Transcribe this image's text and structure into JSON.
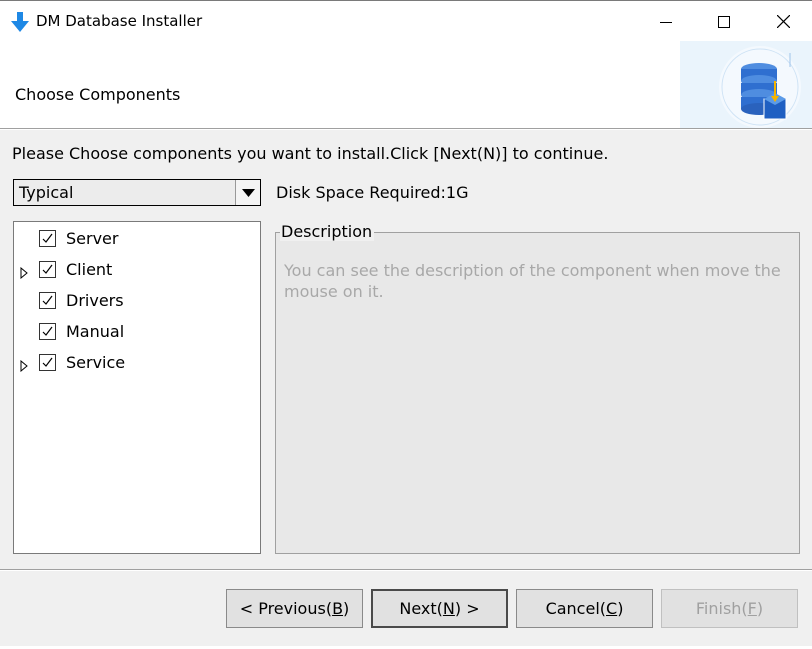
{
  "window": {
    "title": "DM Database Installer",
    "icon": "download-arrow-icon",
    "controls": {
      "minimize": "minimize-icon",
      "maximize": "maximize-icon",
      "close": "close-icon"
    }
  },
  "header": {
    "title": "Choose Components",
    "logo": "database-install-icon"
  },
  "instruction": "Please Choose components you want to install.Click [Next(N)] to continue.",
  "install_type": {
    "selected": "Typical"
  },
  "disk_space": "Disk Space Required:1G",
  "components": [
    {
      "label": "Server",
      "checked": true,
      "expandable": false
    },
    {
      "label": "Client",
      "checked": true,
      "expandable": true
    },
    {
      "label": "Drivers",
      "checked": true,
      "expandable": false
    },
    {
      "label": "Manual",
      "checked": true,
      "expandable": false
    },
    {
      "label": "Service",
      "checked": true,
      "expandable": true
    }
  ],
  "description": {
    "legend": "Description",
    "text": "You can see the description of the component when move the mouse on it."
  },
  "buttons": {
    "previous": {
      "pre": "< Previous(",
      "mnemonic": "B",
      "post": ")"
    },
    "next": {
      "pre": "Next(",
      "mnemonic": "N",
      "post": ") >"
    },
    "cancel": {
      "pre": "Cancel(",
      "mnemonic": "C",
      "post": ")"
    },
    "finish": {
      "pre": "Finish(",
      "mnemonic": "F",
      "post": ")",
      "enabled": false
    }
  },
  "colors": {
    "accent_blue": "#1e88e5",
    "logo_bg": "#eaf4fc",
    "disabled_text": "#a0a0a0"
  }
}
